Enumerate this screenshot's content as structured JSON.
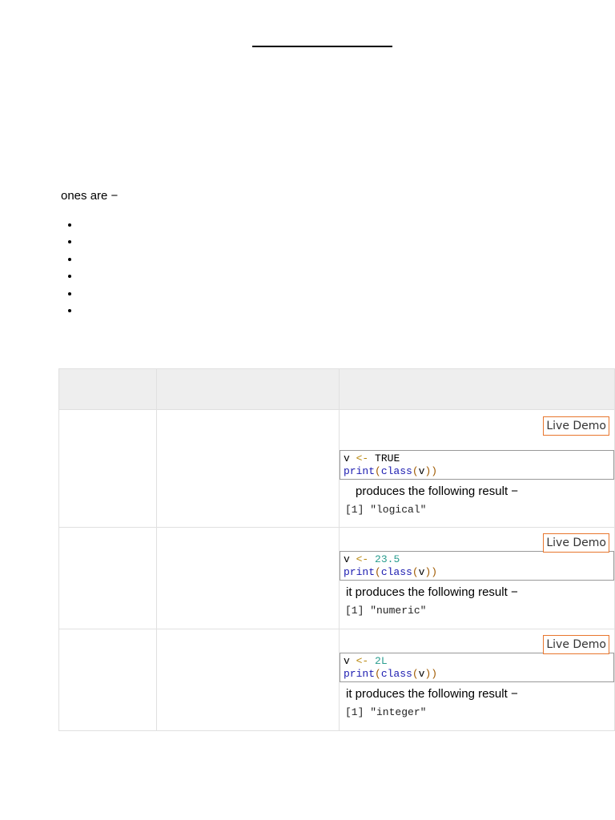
{
  "intro": {
    "text": "ones are −"
  },
  "bullets_count": 6,
  "table": {
    "rows": [
      {
        "demo_label": "Live Demo",
        "code_var": "v",
        "code_op": "<-",
        "code_value": "TRUE",
        "code_fn1": "print",
        "code_fn2": "class",
        "code_arg": "v",
        "result_text": "produces the following result −",
        "output": "[1] \"logical\""
      },
      {
        "demo_label": "Live Demo",
        "code_var": "v",
        "code_op": "<-",
        "code_value": "23.5",
        "code_fn1": "print",
        "code_fn2": "class",
        "code_arg": "v",
        "result_text": "it produces the following result −",
        "output": "[1] \"numeric\""
      },
      {
        "demo_label": "Live Demo",
        "code_var": "v",
        "code_op": "<-",
        "code_value": "2L",
        "code_fn1": "print",
        "code_fn2": "class",
        "code_arg": "v",
        "result_text": "it produces the following result −",
        "output": "[1] \"integer\""
      }
    ]
  },
  "colors": {
    "demo_border": "#e8762d",
    "header_bg": "#eeeeee"
  }
}
